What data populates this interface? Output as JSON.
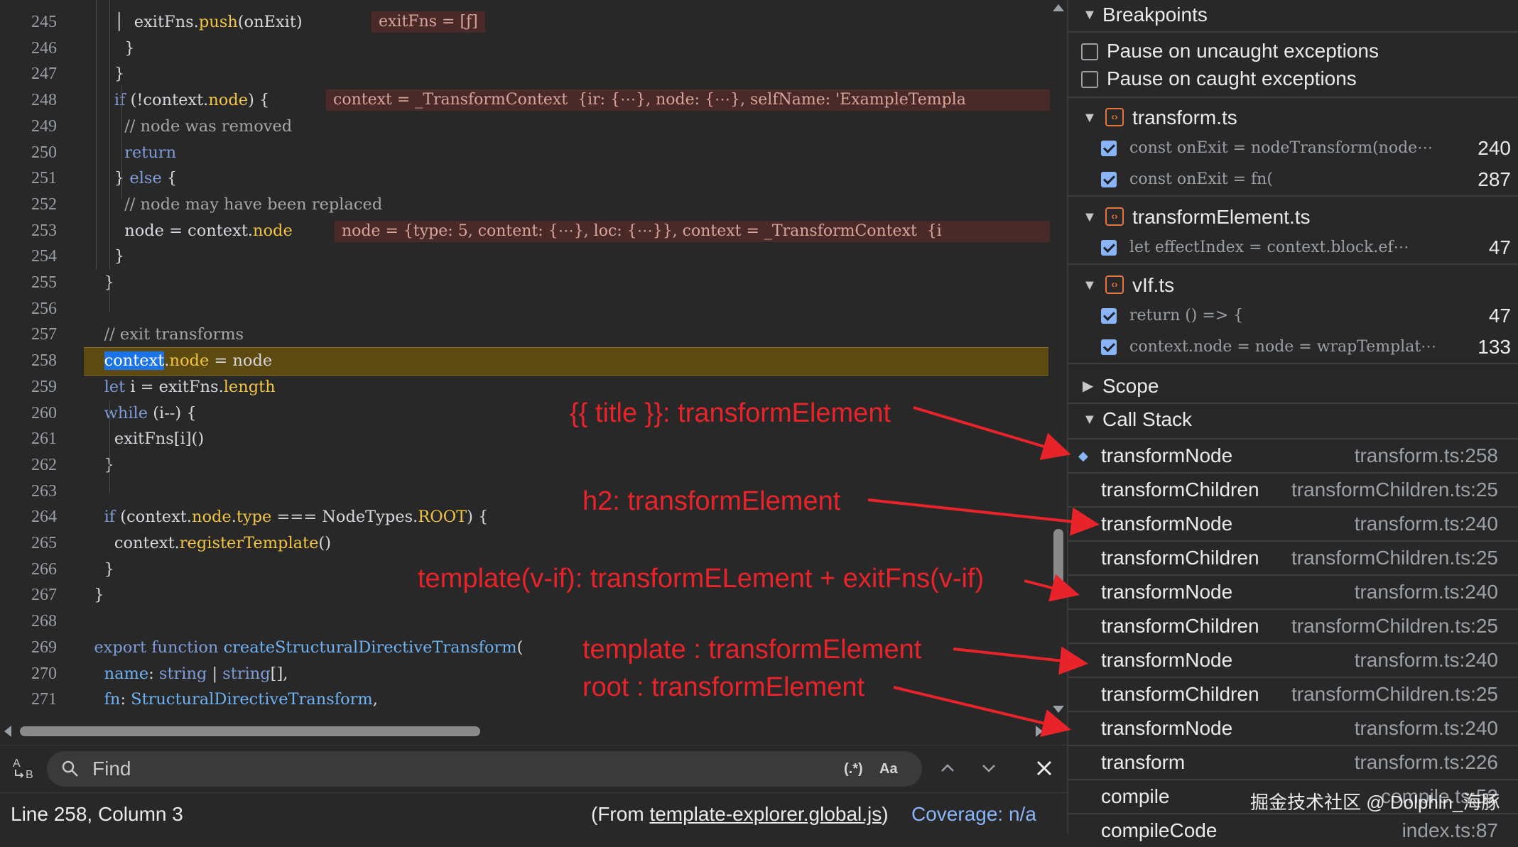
{
  "editor": {
    "lines": [
      {
        "n": "245",
        "html": "      │  exitFns.<span class=\"p\">push</span>(onExit)"
      },
      {
        "n": "246",
        "html": "        }"
      },
      {
        "n": "247",
        "html": "      }"
      },
      {
        "n": "248",
        "html": "      <span class=\"k\">if</span> (!context.<span class=\"p\">node</span>) {"
      },
      {
        "n": "249",
        "html": "        <span class=\"c\">// node was removed</span>"
      },
      {
        "n": "250",
        "html": "        <span class=\"k\">return</span>"
      },
      {
        "n": "251",
        "html": "      } <span class=\"k\">else</span> {"
      },
      {
        "n": "252",
        "html": "        <span class=\"c\">// node may have been replaced</span>"
      },
      {
        "n": "253",
        "html": "        node = context.<span class=\"p\">node</span>"
      },
      {
        "n": "254",
        "html": "      }"
      },
      {
        "n": "255",
        "html": "    }"
      },
      {
        "n": "256",
        "html": ""
      },
      {
        "n": "257",
        "html": "    <span class=\"c\">// exit transforms</span>"
      },
      {
        "n": "258",
        "html": "    <span class=\"sel\">context</span>.<span class=\"p\">node</span> = node"
      },
      {
        "n": "259",
        "html": "    <span class=\"k\">let</span> i = exitFns.<span class=\"p\">length</span>"
      },
      {
        "n": "260",
        "html": "    <span class=\"k\">while</span> (i--) {"
      },
      {
        "n": "261",
        "html": "      exitFns[i]()"
      },
      {
        "n": "262",
        "html": "    }"
      },
      {
        "n": "263",
        "html": ""
      },
      {
        "n": "264",
        "html": "    <span class=\"k\">if</span> (context.<span class=\"p\">node</span>.<span class=\"p\">type</span> === NodeTypes.<span class=\"p\">ROOT</span>) {"
      },
      {
        "n": "265",
        "html": "      context.<span class=\"p\">registerTemplate</span>()"
      },
      {
        "n": "266",
        "html": "    }"
      },
      {
        "n": "267",
        "html": "  }"
      },
      {
        "n": "268",
        "html": ""
      },
      {
        "n": "269",
        "html": "  <span class=\"k\">export</span> <span class=\"k\">function</span> <span class=\"fn\">createStructuralDirectiveTransform</span>("
      },
      {
        "n": "270",
        "html": "    <span class=\"fn\">name</span>: <span class=\"k\">string</span> | <span class=\"k\">string</span>[],"
      },
      {
        "n": "271",
        "html": "    <span class=\"fn\">fn</span>: <span class=\"fn\">StructuralDirectiveTransform</span>,"
      }
    ],
    "inline_values": {
      "exitfns": "exitFns = [ƒ]",
      "context": "context = _TransformContext  {ir: {⋯}, node: {⋯}, selfName: 'ExampleTempla",
      "node": "node = {type: 5, content: {⋯}, loc: {⋯}}, context = _TransformContext  {i"
    }
  },
  "findbar": {
    "placeholder": "Find",
    "regex_label": "(.*)",
    "case_label": "Aa"
  },
  "status": {
    "position": "Line 258, Column 3",
    "from_prefix": "(From ",
    "from_file": "template-explorer.global.js",
    "from_suffix": ")",
    "coverage": "Coverage: n/a"
  },
  "sidebar": {
    "breakpoints_title": "Breakpoints",
    "pause_uncaught": "Pause on uncaught exceptions",
    "pause_caught": "Pause on caught exceptions",
    "files": [
      {
        "name": "transform.ts",
        "bps": [
          {
            "code": "const onExit = nodeTransform(node⋯",
            "line": "240"
          },
          {
            "code": "const onExit = fn(",
            "line": "287"
          }
        ]
      },
      {
        "name": "transformElement.ts",
        "bps": [
          {
            "code": "let effectIndex = context.block.ef⋯",
            "line": "47"
          }
        ]
      },
      {
        "name": "vIf.ts",
        "bps": [
          {
            "code": "return () => {",
            "line": "47"
          },
          {
            "code": "context.node = node = wrapTemplat⋯",
            "line": "133"
          }
        ]
      }
    ],
    "scope_title": "Scope",
    "callstack_title": "Call Stack",
    "frames": [
      {
        "name": "transformNode",
        "loc": "transform.ts:258"
      },
      {
        "name": "transformChildren",
        "loc": "transformChildren.ts:25"
      },
      {
        "name": "transformNode",
        "loc": "transform.ts:240"
      },
      {
        "name": "transformChildren",
        "loc": "transformChildren.ts:25"
      },
      {
        "name": "transformNode",
        "loc": "transform.ts:240"
      },
      {
        "name": "transformChildren",
        "loc": "transformChildren.ts:25"
      },
      {
        "name": "transformNode",
        "loc": "transform.ts:240"
      },
      {
        "name": "transformChildren",
        "loc": "transformChildren.ts:25"
      },
      {
        "name": "transformNode",
        "loc": "transform.ts:240"
      },
      {
        "name": "transform",
        "loc": "transform.ts:226"
      },
      {
        "name": "compile",
        "loc": "compile.ts:52"
      },
      {
        "name": "compileCode",
        "loc": "index.ts:87"
      }
    ]
  },
  "annotations": {
    "a1": "{{ title }}: transformElement",
    "a2": "h2: transformElement",
    "a3": "template(v-if): transformELement + exitFns(v-if)",
    "a4": "template : transformElement",
    "a5": "root : transformElement"
  },
  "watermark": "掘金技术社区 @ Dolphin_海豚",
  "colors": {
    "annotation": "#e8232a",
    "highlight_line": "#5c4a10",
    "accent": "#8ab4f8"
  }
}
